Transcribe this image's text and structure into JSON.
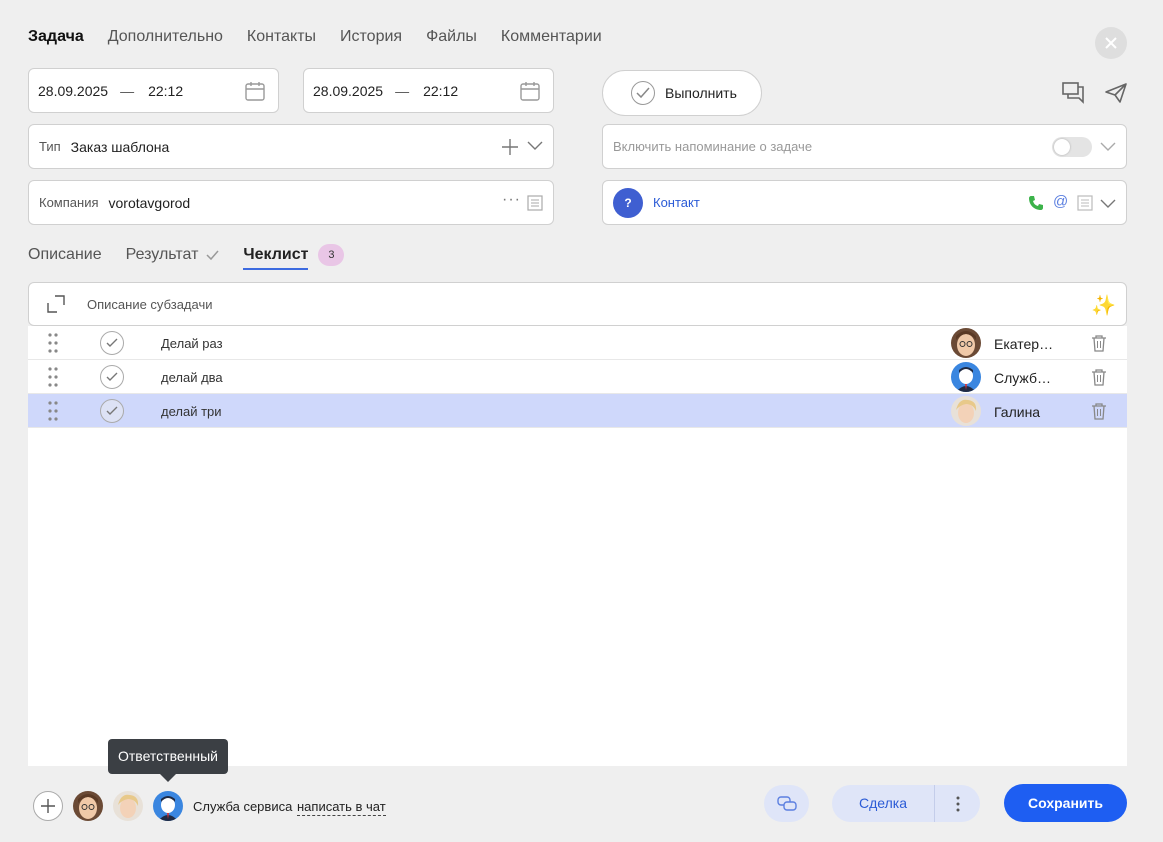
{
  "tabs": [
    "Задача",
    "Дополнительно",
    "Контакты",
    "История",
    "Файлы",
    "Комментарии"
  ],
  "date_start": {
    "date": "28.09.2025",
    "sep": "—",
    "time": "22:12"
  },
  "date_end": {
    "date": "28.09.2025",
    "sep": "—",
    "time": "22:12"
  },
  "execute_label": "Выполнить",
  "type_field": {
    "label": "Тип",
    "value": "Заказ шаблона"
  },
  "reminder": {
    "placeholder": "Включить напоминание о задаче",
    "enabled": false
  },
  "company_field": {
    "label": "Компания",
    "value": "vorotavgorod"
  },
  "contact": {
    "badge": "?",
    "value": "Контакт"
  },
  "subtabs": {
    "description": "Описание",
    "result": "Результат",
    "checklist": "Чеклист",
    "checklist_count": "3"
  },
  "subtask_placeholder": "Описание субзадачи",
  "checklist": [
    {
      "text": "Делай раз",
      "assignee": "Екатер…",
      "avatar": "woman-glasses"
    },
    {
      "text": "делай два",
      "assignee": "Служб…",
      "avatar": "service-man"
    },
    {
      "text": "делай три",
      "assignee": "Галина",
      "avatar": "woman-blonde"
    }
  ],
  "tooltip": "Ответственный",
  "footer": {
    "responsible_name": "Служба сервиса",
    "chat_link": "написать в чат",
    "deal_label": "Сделка",
    "save_label": "Сохранить"
  },
  "colors": {
    "accent": "#1e5ef2",
    "selected_row": "#cfd8fb",
    "badge": "#e9c6e6"
  }
}
